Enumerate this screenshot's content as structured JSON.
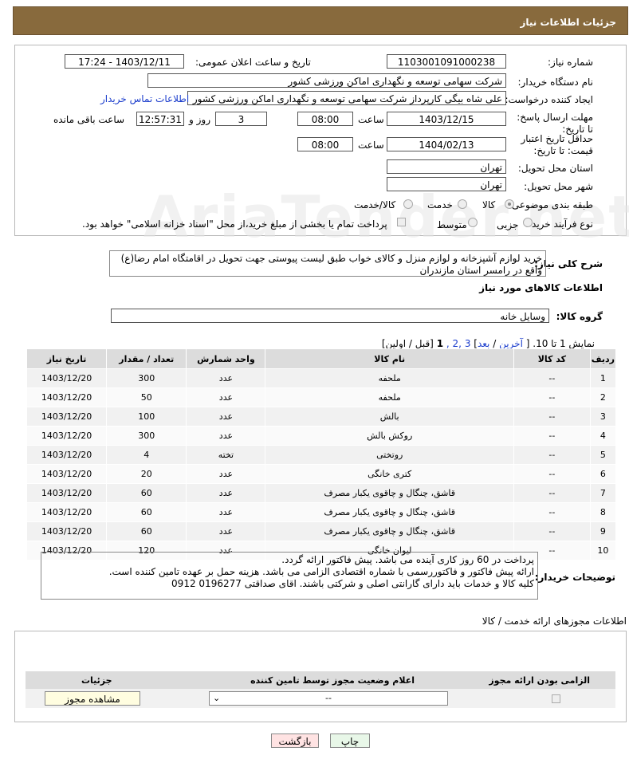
{
  "header": {
    "title": "جزئیات اطلاعات نیاز"
  },
  "form": {
    "need_number_label": "شماره نیاز:",
    "need_number": "1103001091000238",
    "announce_label": "تاریخ و ساعت اعلان عمومی:",
    "announce_value": "1403/12/11 - 17:24",
    "buyer_label": "نام دستگاه خریدار:",
    "buyer_value": "شرکت سهامی توسعه و نگهداری اماکن ورزشی کشور",
    "creator_label": "ایجاد کننده درخواست:",
    "creator_value": "علی شاه بیگی کارپرداز شرکت سهامی توسعه و نگهداری اماکن ورزشی کشور",
    "contact_link": "اطلاعات تماس خریدار",
    "deadline_label": "مهلت ارسال پاسخ: تا تاریخ:",
    "deadline_date": "1403/12/15",
    "time_label": "ساعت",
    "deadline_time": "08:00",
    "days_value": "3",
    "days_label": "روز و",
    "remaining_time": "12:57:31",
    "remaining_label": "ساعت باقی مانده",
    "validity_label": "حداقل تاریخ اعتبار قیمت: تا تاریخ:",
    "validity_date": "1404/02/13",
    "validity_time": "08:00",
    "province_label": "استان محل تحویل:",
    "province_value": "تهران",
    "city_label": "شهر محل تحویل:",
    "city_value": "تهران",
    "category_label": "طبقه بندی موضوعی:",
    "category_options": [
      "کالا",
      "خدمت",
      "کالا/خدمت"
    ],
    "category_selected": "کالا",
    "purchase_type_label": "نوع فرآیند خرید :",
    "purchase_options": [
      "جزیی",
      "متوسط"
    ],
    "purchase_note": "پرداخت تمام یا بخشی از مبلغ خرید،از محل \"اسناد خزانه اسلامی\" خواهد بود."
  },
  "description": {
    "label": "شرح کلی نیاز:",
    "text": "خرید لوازم آشپزخانه و لوازم منزل و کالای خواب طبق لیست پیوستی جهت تحویل در اقامتگاه امام رضا(ع) واقع در رامسر استان مازندران"
  },
  "goods": {
    "section_title": "اطلاعات کالاهای مورد نیاز",
    "group_label": "گروه کالا:",
    "group_value": "وسایل خانه",
    "paging_prefix": "نمایش 1 تا 10. [",
    "paging_last": "آخرین",
    "paging_next": "بعد",
    "paging_pages": "3 ,2 ,",
    "paging_current": "1",
    "paging_suffix": "[قبل / اولین]",
    "columns": [
      "ردیف",
      "کد کالا",
      "نام کالا",
      "واحد شمارش",
      "تعداد / مقدار",
      "تاریخ نیاز"
    ],
    "rows": [
      [
        "1",
        "--",
        "ملحفه",
        "عدد",
        "300",
        "1403/12/20"
      ],
      [
        "2",
        "--",
        "ملحفه",
        "عدد",
        "50",
        "1403/12/20"
      ],
      [
        "3",
        "--",
        "بالش",
        "عدد",
        "100",
        "1403/12/20"
      ],
      [
        "4",
        "--",
        "روکش بالش",
        "عدد",
        "300",
        "1403/12/20"
      ],
      [
        "5",
        "--",
        "روتختی",
        "تخته",
        "4",
        "1403/12/20"
      ],
      [
        "6",
        "--",
        "کتری خانگی",
        "عدد",
        "20",
        "1403/12/20"
      ],
      [
        "7",
        "--",
        "قاشق، چنگال و چاقوی یکبار مصرف",
        "عدد",
        "60",
        "1403/12/20"
      ],
      [
        "8",
        "--",
        "قاشق، چنگال و چاقوی یکبار مصرف",
        "عدد",
        "60",
        "1403/12/20"
      ],
      [
        "9",
        "--",
        "قاشق، چنگال و چاقوی یکبار مصرف",
        "عدد",
        "60",
        "1403/12/20"
      ],
      [
        "10",
        "--",
        "لیوان خانگی",
        "عدد",
        "120",
        "1403/12/20"
      ]
    ]
  },
  "buyer_notes": {
    "label": "توضیحات خریدار:",
    "line1": "پرداخت در 60 روز کاری آینده می باشد. پیش فاکتور ارائه گردد.",
    "line2": "ارائه پیش فاکتور و فاکتوررسمی با شماره اقتصادی الزامی می باشد. هزینه حمل بر عهده تامین کننده است.",
    "line3": "کلیه کالا و خدمات باید دارای گارانتی اصلی و شرکتی باشند. اقای صداقتی 0196277   0912"
  },
  "permits": {
    "title": "اطلاعات مجوزهای ارائه خدمت / کالا",
    "col_required": "الزامی بودن ارائه مجوز",
    "col_status": "اعلام وضعیت مجوز توسط تامین کننده",
    "col_details": "جزئیات",
    "select_value": "--",
    "view_button": "مشاهده مجوز"
  },
  "actions": {
    "print": "چاپ",
    "back": "بازگشت"
  },
  "watermark": "AriaTender.net"
}
